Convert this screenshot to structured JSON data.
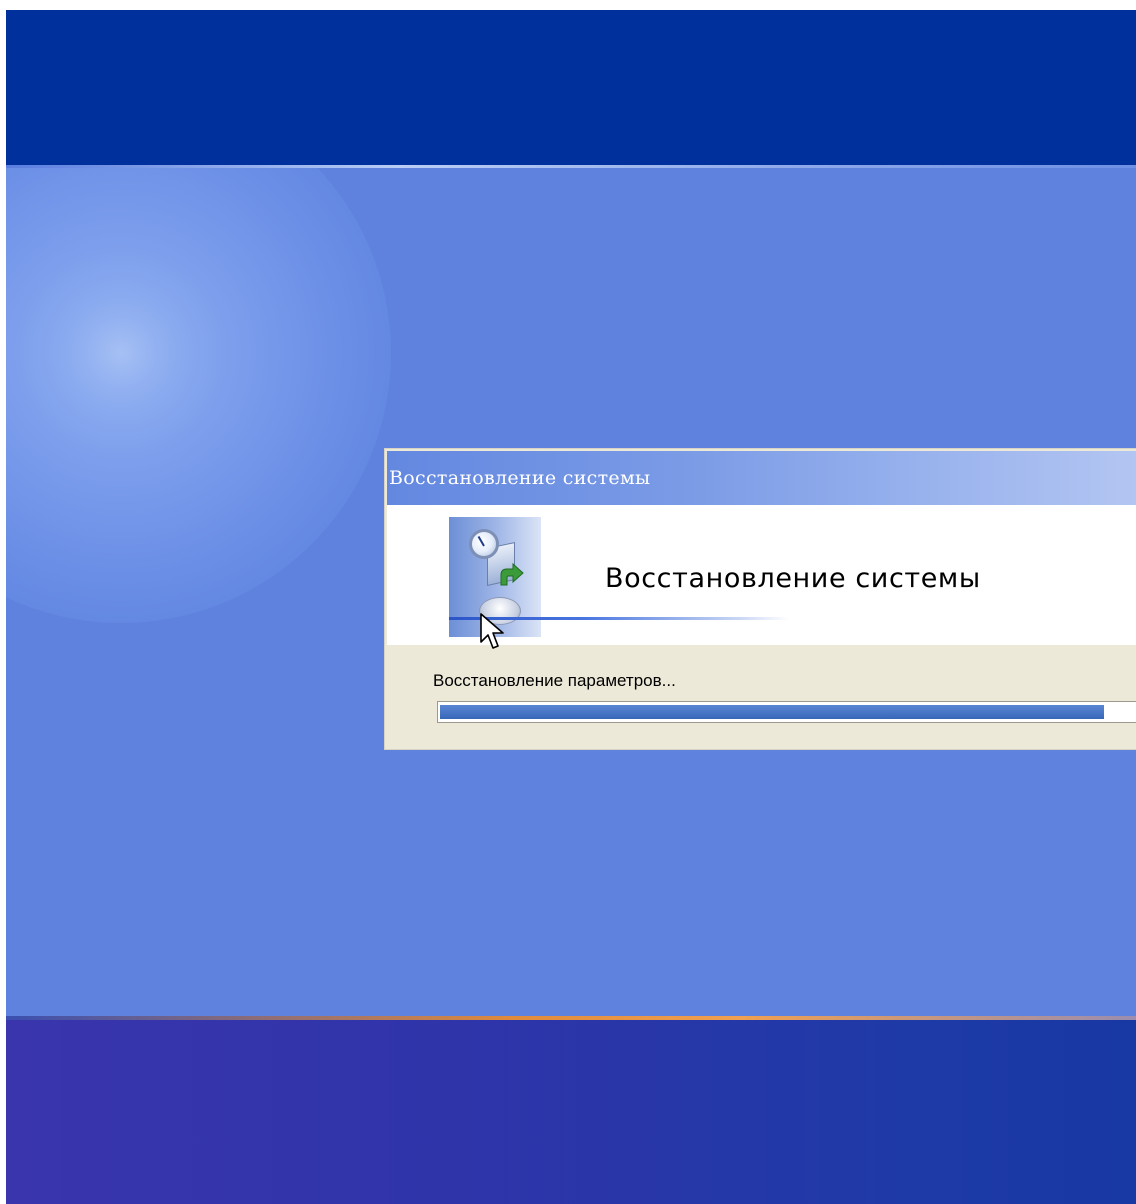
{
  "dialog": {
    "title_bar": "Восстановление системы",
    "header_title": "Восстановление системы",
    "status_text": "Восстановление параметров...",
    "progress_fraction": 0.94
  },
  "icons": {
    "header_art": "system-restore-icon",
    "cursor": "mouse-pointer-icon"
  },
  "colors": {
    "top_band": "#00309c",
    "desktop_blue": "#5f82df",
    "bottom_band": "#2f34a9",
    "dialog_face": "#ece9d8",
    "progress_fill": "#3867b8"
  }
}
